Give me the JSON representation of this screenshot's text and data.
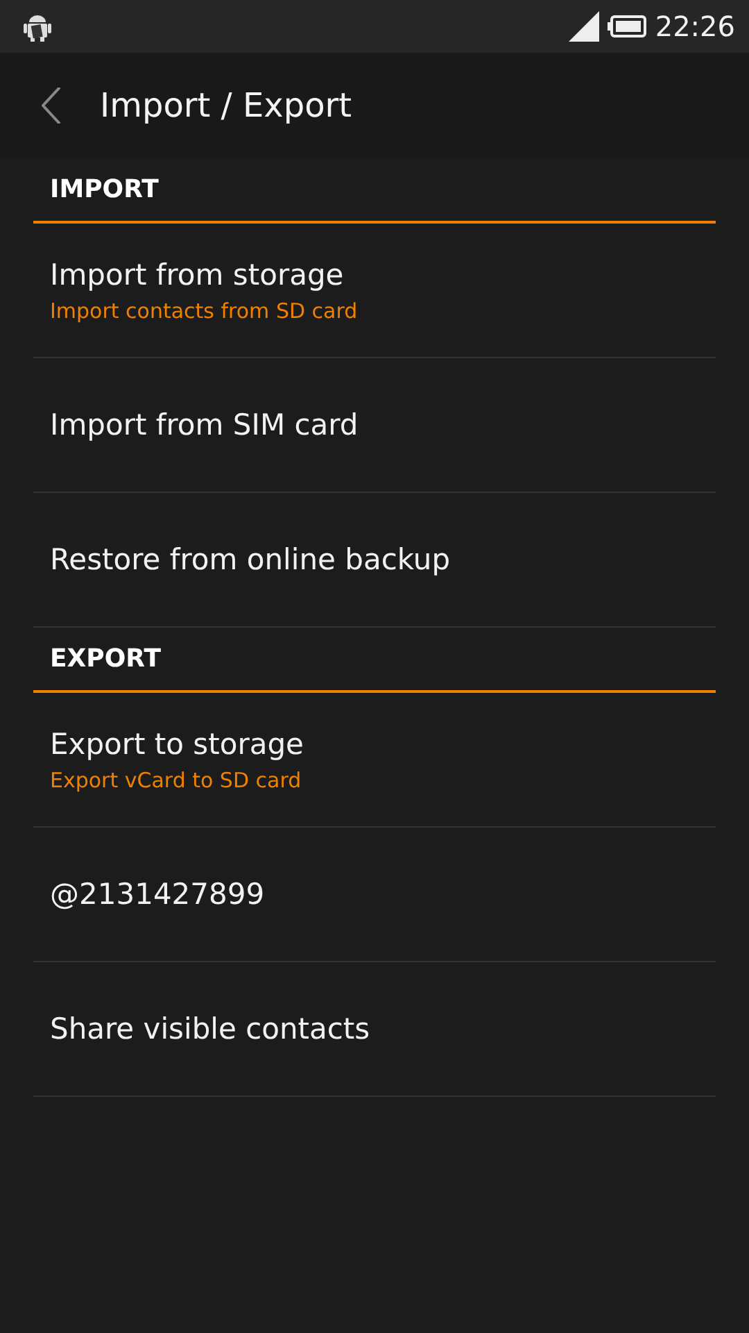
{
  "status_bar": {
    "time": "22:26"
  },
  "header": {
    "title": "Import / Export"
  },
  "sections": [
    {
      "title": "IMPORT",
      "items": [
        {
          "title": "Import from storage",
          "subtitle": "Import contacts from SD card"
        },
        {
          "title": "Import from SIM card"
        },
        {
          "title": "Restore from online backup"
        }
      ]
    },
    {
      "title": "EXPORT",
      "items": [
        {
          "title": "Export to storage",
          "subtitle": "Export vCard to SD card"
        },
        {
          "title": "@2131427899"
        },
        {
          "title": "Share visible contacts"
        }
      ]
    }
  ]
}
